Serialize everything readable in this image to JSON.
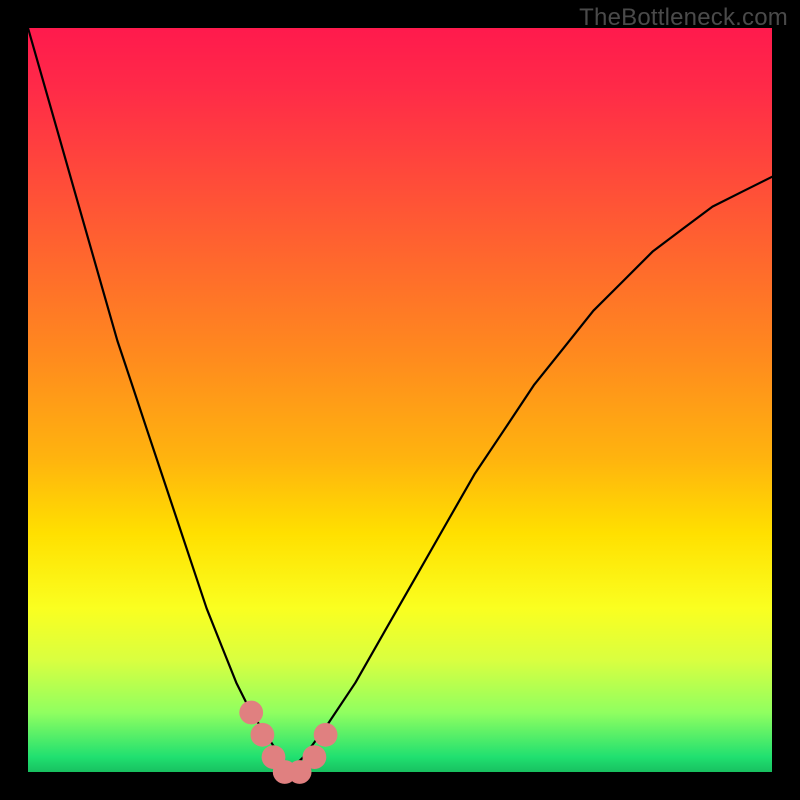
{
  "watermark": "TheBottleneck.com",
  "colors": {
    "frame": "#000000",
    "curve": "#000000",
    "marker": "#e08080",
    "gradient_top": "#ff1a4d",
    "gradient_bottom": "#18c060"
  },
  "chart_data": {
    "type": "line",
    "title": "",
    "xlabel": "",
    "ylabel": "",
    "xlim": [
      0,
      100
    ],
    "ylim": [
      0,
      100
    ],
    "series": [
      {
        "name": "bottleneck-curve",
        "x": [
          0,
          2,
          4,
          6,
          8,
          10,
          12,
          14,
          16,
          18,
          20,
          22,
          24,
          26,
          28,
          30,
          32,
          34,
          35,
          37,
          40,
          44,
          48,
          52,
          56,
          60,
          64,
          68,
          72,
          76,
          80,
          84,
          88,
          92,
          96,
          100
        ],
        "values": [
          100,
          93,
          86,
          79,
          72,
          65,
          58,
          52,
          46,
          40,
          34,
          28,
          22,
          17,
          12,
          8,
          5,
          2,
          0,
          2,
          6,
          12,
          19,
          26,
          33,
          40,
          46,
          52,
          57,
          62,
          66,
          70,
          73,
          76,
          78,
          80
        ]
      }
    ],
    "markers": [
      {
        "x": 30.0,
        "y": 8
      },
      {
        "x": 31.5,
        "y": 5
      },
      {
        "x": 33.0,
        "y": 2
      },
      {
        "x": 34.5,
        "y": 0
      },
      {
        "x": 36.5,
        "y": 0
      },
      {
        "x": 38.5,
        "y": 2
      },
      {
        "x": 40.0,
        "y": 5
      }
    ],
    "marker_radius_pct": 1.6
  }
}
